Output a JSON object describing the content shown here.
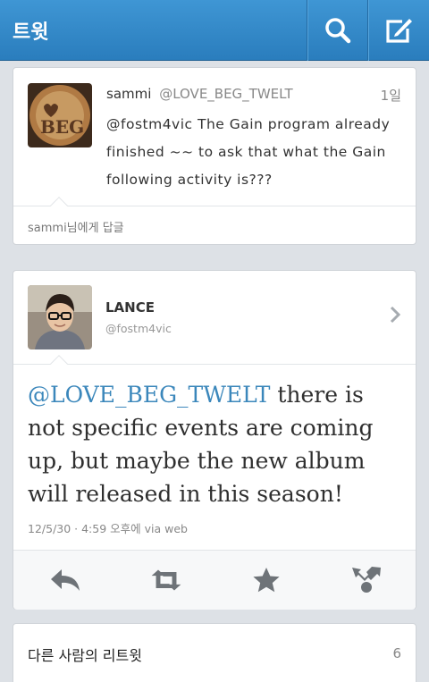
{
  "header": {
    "title": "트윗"
  },
  "tweet": {
    "name": "sammi",
    "handle": "@LOVE_BEG_TWELT",
    "time": "1일",
    "text": "@fostm4vic The Gain program already finished ~~ to ask that what the Gain following activity is???",
    "reply_label": "sammi님에게 답글"
  },
  "reply": {
    "name": "LANCE",
    "handle": "@fostm4vic",
    "mention": "@LOVE_BEG_TWELT",
    "text": " there is not specific events are coming up, but maybe the new album will released in this season!",
    "meta": "12/5/30 · 4:59 오후에 via web"
  },
  "retweets": {
    "label": "다른 사람의 리트윗",
    "count": "6"
  },
  "colors": {
    "header": "#2a7dbd",
    "accent": "#3b87bb",
    "icon": "#6e7378"
  }
}
